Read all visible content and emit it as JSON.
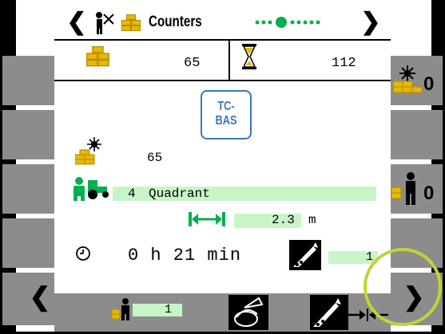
{
  "header": {
    "title": "Counters",
    "page_dots": "●●●●●●●",
    "prev_arrow": "❮",
    "next_arrow": "❯"
  },
  "top_row": {
    "bales_count": "65",
    "timer_count": "112"
  },
  "logo": {
    "text": "TC-BAS"
  },
  "bales_sun_count": "65",
  "operator": {
    "number": "4",
    "name": "Quadrant"
  },
  "length": {
    "value": "2.3",
    "unit": "m"
  },
  "time": {
    "text": "0 h 21 min"
  },
  "knife_value": "1",
  "right_buttons": {
    "reset_sun_label": "0",
    "reset_operator_label": "0"
  },
  "footer": {
    "left_arrow": "❮",
    "right_arrow": "❯",
    "person_value": "1"
  },
  "colors": {
    "accent_green": "#00b050",
    "field_green": "#c8f5c8",
    "hay_yellow": "#e6b800",
    "logo_blue": "#3a78b8"
  }
}
